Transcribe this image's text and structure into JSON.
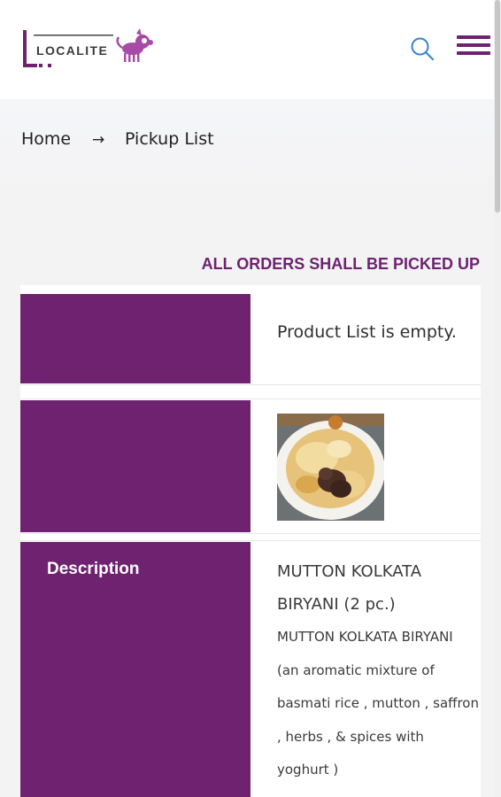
{
  "header": {
    "logo_text": "LOCALITE",
    "icons": {
      "search": "search-icon",
      "menu": "hamburger-menu-icon"
    },
    "brand_color": "#6e2270",
    "search_color": "#3b82d6"
  },
  "breadcrumb": {
    "home": "Home",
    "separator": "→",
    "current": "Pickup List"
  },
  "notice": "ALL ORDERS SHALL BE PICKED UP",
  "table": {
    "rows": [
      {
        "label": "",
        "value": "Product List is empty."
      },
      {
        "label": "",
        "image": "biryani-photo"
      },
      {
        "label": "Description",
        "title": "MUTTON KOLKATA BIRYANI (2 pc.)",
        "body": "MUTTON KOLKATA BIRYANI (an aromatic mixture of basmati rice , mutton , saffron , herbs , & spices with yoghurt )"
      }
    ]
  }
}
